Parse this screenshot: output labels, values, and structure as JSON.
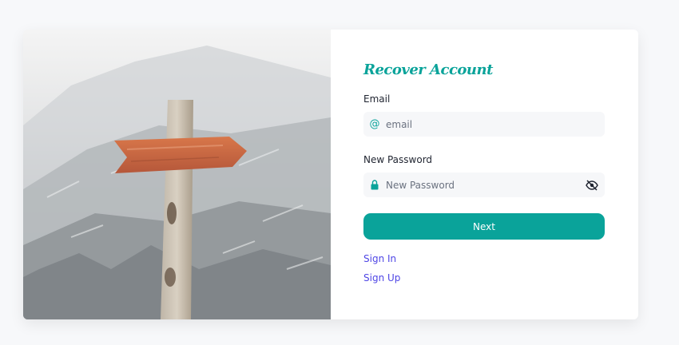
{
  "form": {
    "title": "Recover Account",
    "email_label": "Email",
    "email_placeholder": "email",
    "email_icon": "at-icon",
    "password_label": "New Password",
    "password_placeholder": "New Password",
    "password_icon": "lock-icon",
    "toggle_icon": "eye-off-icon",
    "next_label": "Next",
    "signin_label": "Sign In",
    "signup_label": "Sign Up"
  },
  "colors": {
    "accent": "#0aa39a",
    "link": "#4f46e5",
    "background": "#f7f8fa"
  }
}
